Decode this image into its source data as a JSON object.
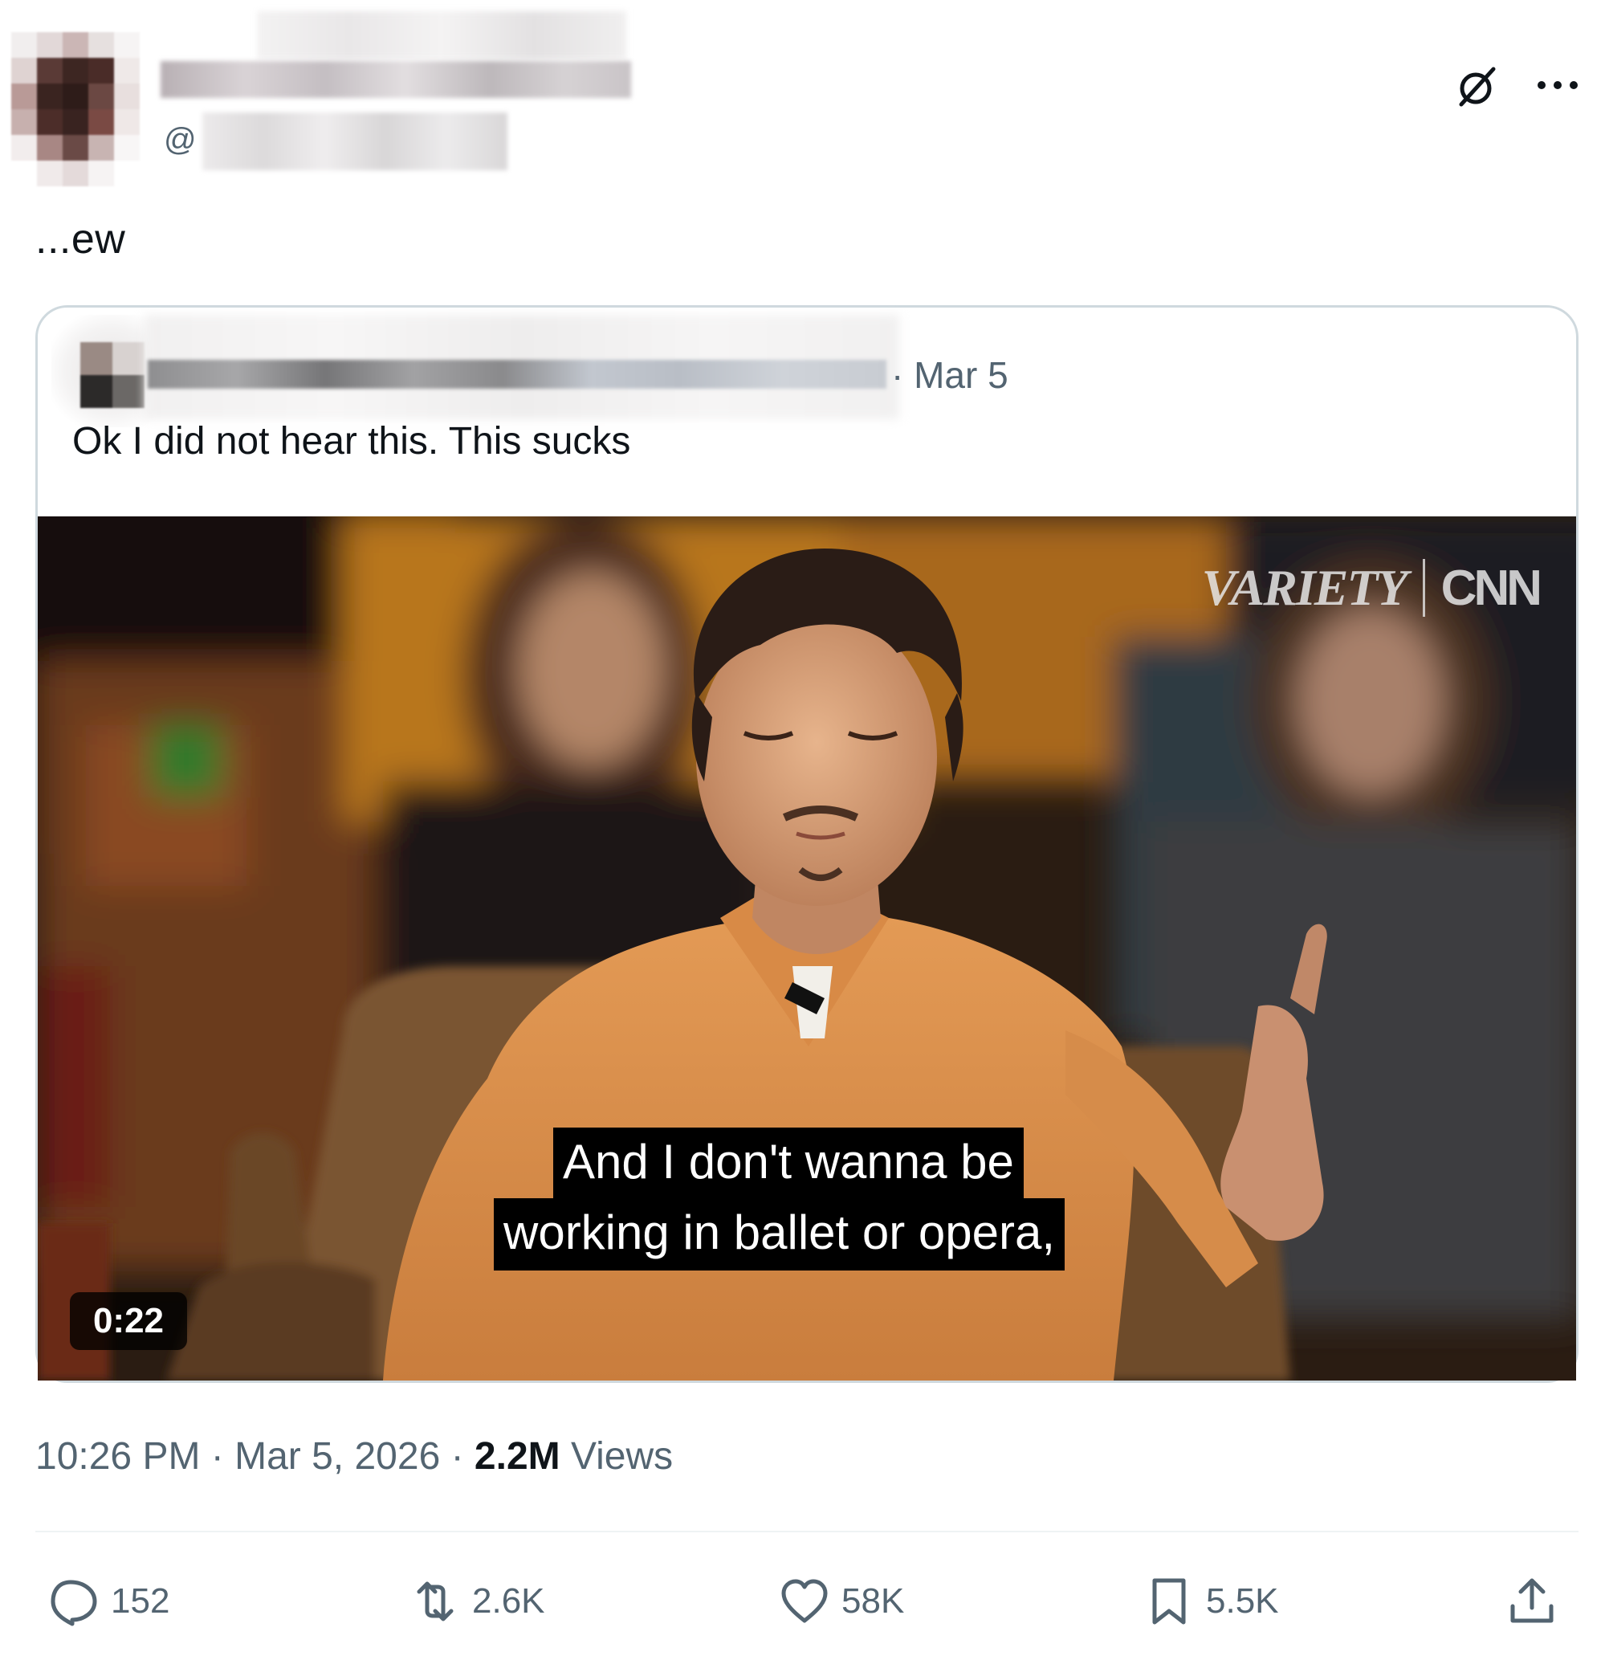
{
  "tweet": {
    "author": {
      "display_name": "",
      "handle_prefix": "@"
    },
    "text": "...ew",
    "timestamp": "10:26 PM · Mar 5, 2026 · ",
    "views_count": "2.2M",
    "views_label": " Views"
  },
  "quote": {
    "date": "· Mar 5",
    "text": "Ok I did not hear this. This sucks",
    "video": {
      "caption_line1": "And I don't wanna be",
      "caption_line2": "working in ballet or opera,",
      "duration": "0:22",
      "watermark_left": "VARIETY",
      "watermark_right": "CNN"
    }
  },
  "actions": {
    "replies": "152",
    "reposts": "2.6K",
    "likes": "58K",
    "bookmarks": "5.5K"
  },
  "icons": [
    "grok-icon",
    "more-icon",
    "reply-icon",
    "repost-icon",
    "like-icon",
    "bookmark-icon",
    "share-icon"
  ],
  "colors": {
    "text": "#0f1419",
    "muted": "#536471",
    "border": "#cfd9de"
  }
}
